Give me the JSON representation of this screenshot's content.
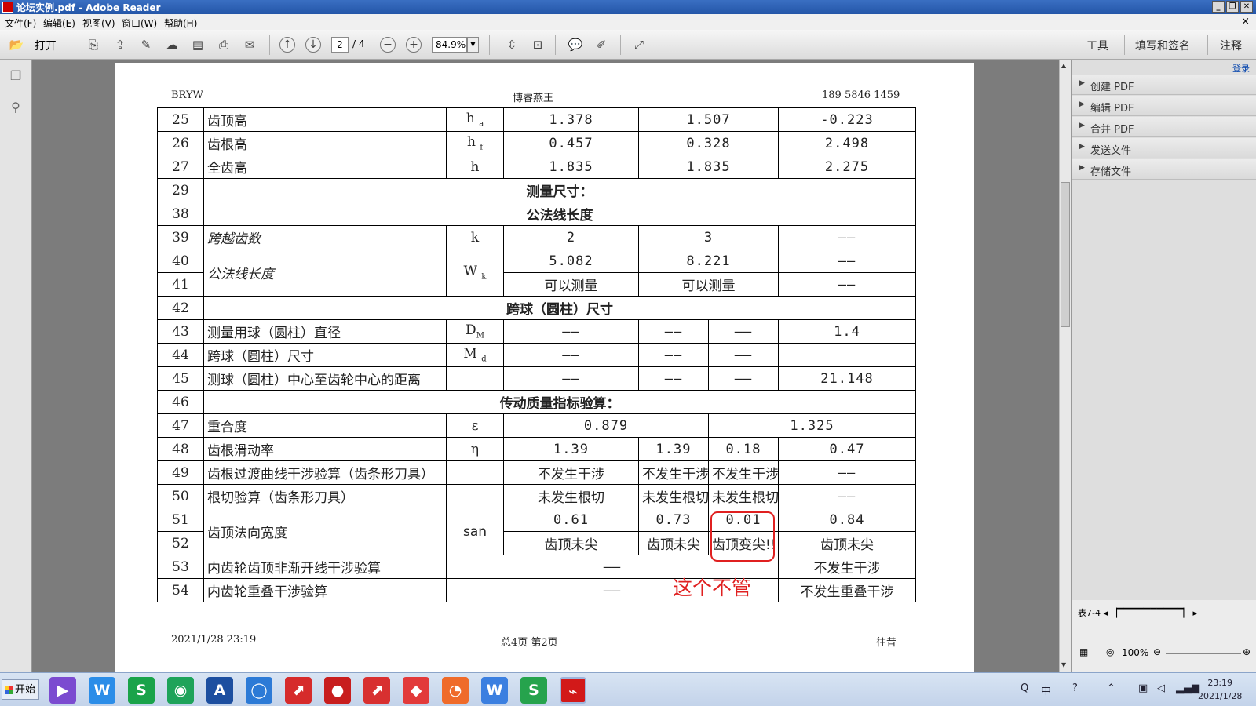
{
  "window": {
    "title": "论坛实例.pdf - Adobe Reader",
    "min": "_",
    "max": "❐",
    "close": "✕"
  },
  "menu": {
    "file": "文件(F)",
    "edit": "编辑(E)",
    "view": "视图(V)",
    "window": "窗口(W)",
    "help": "帮助(H)",
    "close_doc": "×"
  },
  "toolbar": {
    "open": "打开",
    "page_current": "2",
    "page_total": "/ 4",
    "zoom": "84.9%",
    "tools": "工具",
    "fill_sign": "填写和签名",
    "comment": "注释"
  },
  "doc": {
    "header_left": "BRYW",
    "header_center": "博睿燕王",
    "header_right": "189 5846 1459",
    "footer_left": "2021/1/28   23:19",
    "footer_center": "总4页    第2页",
    "footer_right": "往昔",
    "annotation": "这个不管",
    "rows": [
      {
        "no": "25",
        "name": "齿顶高",
        "sym": "h",
        "sub": "a",
        "v1": "1.378",
        "v2": "1.507",
        "v3": "-0.223"
      },
      {
        "no": "26",
        "name": "齿根高",
        "sym": "h",
        "sub": "f",
        "v1": "0.457",
        "v2": "0.328",
        "v3": "2.498"
      },
      {
        "no": "27",
        "name": "全齿高",
        "sym": "h",
        "sub": "",
        "v1": "1.835",
        "v2": "1.835",
        "v3": "2.275"
      },
      {
        "no": "29",
        "section": "测量尺寸："
      },
      {
        "no": "38",
        "section": "公法线长度"
      },
      {
        "no": "39",
        "name": "跨越齿数",
        "sym": "k",
        "v1": "2",
        "v2": "3",
        "v3": "——"
      },
      {
        "no": "40",
        "name": "公法线长度",
        "sym": "W",
        "sub": "k",
        "v1": "5.082",
        "v2": "8.221",
        "v3": "——"
      },
      {
        "no": "41",
        "v1": "可以测量",
        "v2": "可以测量",
        "v3": "——"
      },
      {
        "no": "42",
        "section": "跨球（圆柱）尺寸"
      },
      {
        "no": "43",
        "name": "测量用球（圆柱）直径",
        "sym": "D",
        "sub": "M",
        "v1": "——",
        "v2a": "——",
        "v2b": "——",
        "v3": "1.4"
      },
      {
        "no": "44",
        "name": "跨球（圆柱）尺寸",
        "sym": "M",
        "sub": "d",
        "v1": "——",
        "v2a": "——",
        "v2b": "——",
        "v3": ""
      },
      {
        "no": "45",
        "name": "测球（圆柱）中心至齿轮中心的距离",
        "v1": "——",
        "v2a": "——",
        "v2b": "——",
        "v3": "21.148"
      },
      {
        "no": "46",
        "section": "传动质量指标验算："
      },
      {
        "no": "47",
        "name": "重合度",
        "sym": "ε",
        "v1": "0.879",
        "v3": "1.325"
      },
      {
        "no": "48",
        "name": "齿根滑动率",
        "sym": "η",
        "v1": "1.39",
        "v2a": "1.39",
        "v2b": "0.18",
        "v3": "0.47"
      },
      {
        "no": "49",
        "name": "齿根过渡曲线干涉验算（齿条形刀具）",
        "v1": "不发生干涉",
        "v2a": "不发生干涉",
        "v2b": "不发生干涉",
        "v3": "——"
      },
      {
        "no": "50",
        "name": "根切验算（齿条形刀具）",
        "v1": "未发生根切",
        "v2a": "未发生根切",
        "v2b": "未发生根切",
        "v3": "——"
      },
      {
        "no": "51",
        "name": "齿顶法向宽度",
        "sym": "san",
        "v1": "0.61",
        "v2a": "0.73",
        "v2b": "0.01",
        "v3": "0.84"
      },
      {
        "no": "52",
        "v1": "齿顶未尖",
        "v2a": "齿顶未尖",
        "v2b": "齿顶变尖!!",
        "v3": "齿顶未尖"
      },
      {
        "no": "53",
        "name": "内齿轮齿顶非渐开线干涉验算",
        "mid": "——",
        "v3": "不发生干涉"
      },
      {
        "no": "54",
        "name": "内齿轮重叠干涉验算",
        "mid": "——",
        "v3": "不发生重叠干涉"
      }
    ]
  },
  "rightpane": {
    "login": "登录",
    "items": [
      "创建 PDF",
      "编辑 PDF",
      "合并 PDF",
      "发送文件",
      "存储文件"
    ],
    "sheet_tab": "表7-4",
    "zoom": "100%"
  },
  "taskbar": {
    "start": "开始",
    "clock_time": "23:19",
    "clock_date": "2021/1/28",
    "ime": "中"
  },
  "colors": {
    "annotation_red": "#e02020",
    "titlebar_blue": "#2456a8"
  }
}
